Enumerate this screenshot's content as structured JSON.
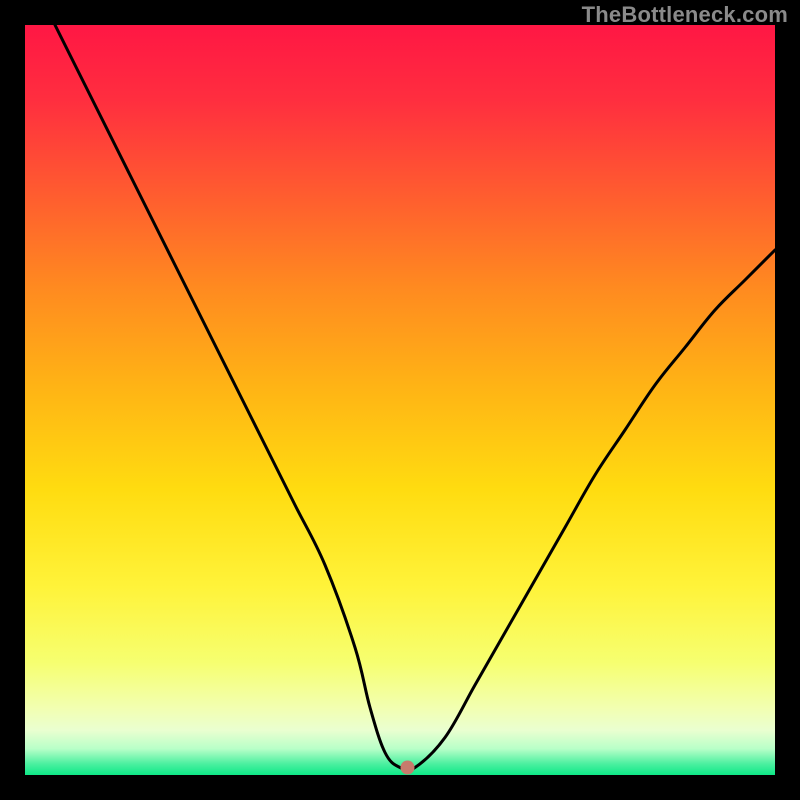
{
  "watermark": "TheBottleneck.com",
  "colors": {
    "marker": "#c77b6c",
    "curve": "#000000",
    "frame": "#000000"
  },
  "chart_data": {
    "type": "line",
    "title": "",
    "xlabel": "",
    "ylabel": "",
    "xlim": [
      0,
      100
    ],
    "ylim": [
      0,
      100
    ],
    "grid": false,
    "legend": false,
    "series": [
      {
        "name": "bottleneck-curve",
        "x": [
          4,
          8,
          12,
          16,
          20,
          24,
          28,
          32,
          36,
          40,
          44,
          46,
          48,
          50,
          52,
          56,
          60,
          64,
          68,
          72,
          76,
          80,
          84,
          88,
          92,
          96,
          100
        ],
        "y": [
          100,
          92,
          84,
          76,
          68,
          60,
          52,
          44,
          36,
          28,
          17,
          9,
          3,
          1,
          1,
          5,
          12,
          19,
          26,
          33,
          40,
          46,
          52,
          57,
          62,
          66,
          70
        ]
      }
    ],
    "marker": {
      "x": 51,
      "y": 1
    },
    "background_gradient_stops": [
      {
        "offset": 0.0,
        "color": "#ff1744"
      },
      {
        "offset": 0.1,
        "color": "#ff2e3f"
      },
      {
        "offset": 0.22,
        "color": "#ff5a30"
      },
      {
        "offset": 0.35,
        "color": "#ff8a20"
      },
      {
        "offset": 0.48,
        "color": "#ffb315"
      },
      {
        "offset": 0.62,
        "color": "#ffdc10"
      },
      {
        "offset": 0.75,
        "color": "#fff33a"
      },
      {
        "offset": 0.85,
        "color": "#f6ff70"
      },
      {
        "offset": 0.91,
        "color": "#f2ffb0"
      },
      {
        "offset": 0.94,
        "color": "#eaffd0"
      },
      {
        "offset": 0.965,
        "color": "#b8ffc8"
      },
      {
        "offset": 0.985,
        "color": "#4cf0a0"
      },
      {
        "offset": 1.0,
        "color": "#0ee887"
      }
    ]
  }
}
